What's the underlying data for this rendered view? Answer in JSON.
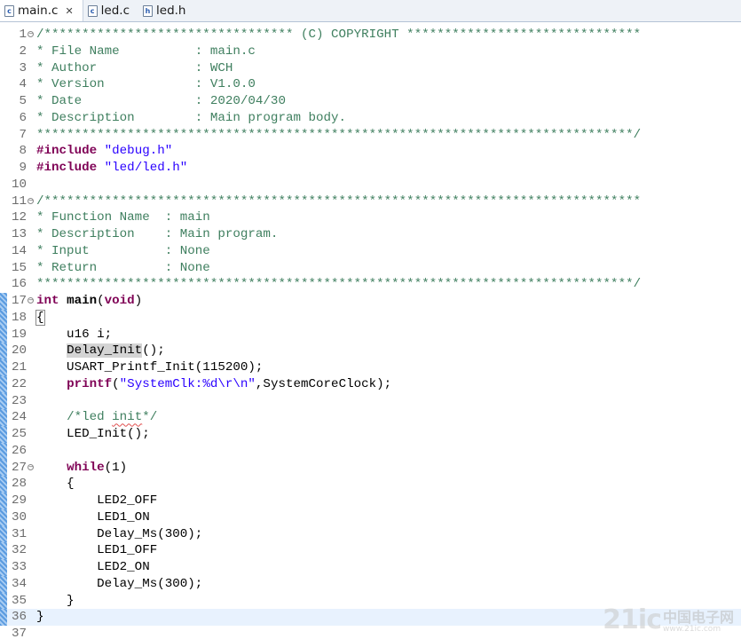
{
  "tabs": [
    {
      "label": "main.c",
      "glyph": "c",
      "active": true,
      "close": "✕"
    },
    {
      "label": "led.c",
      "glyph": "c",
      "active": false
    },
    {
      "label": "led.h",
      "glyph": "h",
      "active": false
    }
  ],
  "watermark": {
    "logo": "21ic",
    "site_cn": "中国电子网",
    "site_url": "www.21ic.com"
  },
  "lines": [
    {
      "n": "1",
      "fold": true,
      "segs": [
        [
          "cm",
          "/********************************* (C) COPYRIGHT *******************************"
        ]
      ]
    },
    {
      "n": "2",
      "segs": [
        [
          "cm",
          "* File Name          : main.c"
        ]
      ]
    },
    {
      "n": "3",
      "segs": [
        [
          "cm",
          "* Author             : WCH"
        ]
      ]
    },
    {
      "n": "4",
      "segs": [
        [
          "cm",
          "* Version            : V1.0.0"
        ]
      ]
    },
    {
      "n": "5",
      "segs": [
        [
          "cm",
          "* Date               : 2020/04/30"
        ]
      ]
    },
    {
      "n": "6",
      "segs": [
        [
          "cm",
          "* Description        : Main program body."
        ]
      ]
    },
    {
      "n": "7",
      "segs": [
        [
          "cm",
          "*******************************************************************************/"
        ]
      ]
    },
    {
      "n": "8",
      "segs": [
        [
          "pp",
          "#include"
        ],
        [
          "",
          " "
        ],
        [
          "str",
          "\"debug.h\""
        ]
      ]
    },
    {
      "n": "9",
      "segs": [
        [
          "pp",
          "#include"
        ],
        [
          "",
          " "
        ],
        [
          "str",
          "\"led/led.h\""
        ]
      ]
    },
    {
      "n": "10",
      "segs": []
    },
    {
      "n": "11",
      "fold": true,
      "segs": [
        [
          "cm",
          "/*******************************************************************************"
        ]
      ]
    },
    {
      "n": "12",
      "segs": [
        [
          "cm",
          "* Function Name  : main"
        ]
      ]
    },
    {
      "n": "13",
      "segs": [
        [
          "cm",
          "* Description    : Main program."
        ]
      ]
    },
    {
      "n": "14",
      "segs": [
        [
          "cm",
          "* Input          : None"
        ]
      ]
    },
    {
      "n": "15",
      "segs": [
        [
          "cm",
          "* Return         : None"
        ]
      ]
    },
    {
      "n": "16",
      "segs": [
        [
          "cm",
          "*******************************************************************************/"
        ]
      ]
    },
    {
      "n": "17",
      "fold": true,
      "mark": true,
      "segs": [
        [
          "kw",
          "int"
        ],
        [
          "",
          " "
        ],
        [
          "fn",
          "main"
        ],
        [
          "",
          "("
        ],
        [
          "kw",
          "void"
        ],
        [
          "",
          ")"
        ]
      ]
    },
    {
      "n": "18",
      "mark": true,
      "segs": [
        [
          "brace",
          "{"
        ]
      ]
    },
    {
      "n": "19",
      "mark": true,
      "segs": [
        [
          "",
          "    u16 i;"
        ]
      ]
    },
    {
      "n": "20",
      "mark": true,
      "segs": [
        [
          "",
          "    "
        ],
        [
          "occ",
          "Delay_Init"
        ],
        [
          "",
          "();"
        ]
      ]
    },
    {
      "n": "21",
      "mark": true,
      "segs": [
        [
          "",
          "    USART_Printf_Init(115200);"
        ]
      ]
    },
    {
      "n": "22",
      "mark": true,
      "segs": [
        [
          "",
          "    "
        ],
        [
          "kw",
          "printf"
        ],
        [
          "",
          "("
        ],
        [
          "str",
          "\"SystemClk:%d\\r\\n\""
        ],
        [
          "",
          ",SystemCoreClock);"
        ]
      ]
    },
    {
      "n": "23",
      "mark": true,
      "segs": []
    },
    {
      "n": "24",
      "mark": true,
      "segs": [
        [
          "",
          "    "
        ],
        [
          "cm",
          "/*led "
        ],
        [
          "cmsq",
          "init"
        ],
        [
          "cm",
          "*/"
        ]
      ]
    },
    {
      "n": "25",
      "mark": true,
      "segs": [
        [
          "",
          "    LED_Init();"
        ]
      ]
    },
    {
      "n": "26",
      "mark": true,
      "segs": []
    },
    {
      "n": "27",
      "fold": true,
      "mark": true,
      "segs": [
        [
          "",
          "    "
        ],
        [
          "kw",
          "while"
        ],
        [
          "",
          "(1)"
        ]
      ]
    },
    {
      "n": "28",
      "mark": true,
      "segs": [
        [
          "",
          "    {"
        ]
      ]
    },
    {
      "n": "29",
      "mark": true,
      "segs": [
        [
          "",
          "        LED2_OFF"
        ]
      ]
    },
    {
      "n": "30",
      "mark": true,
      "segs": [
        [
          "",
          "        LED1_ON"
        ]
      ]
    },
    {
      "n": "31",
      "mark": true,
      "segs": [
        [
          "",
          "        Delay_Ms(300);"
        ]
      ]
    },
    {
      "n": "32",
      "mark": true,
      "segs": [
        [
          "",
          "        LED1_OFF"
        ]
      ]
    },
    {
      "n": "33",
      "mark": true,
      "segs": [
        [
          "",
          "        LED2_ON"
        ]
      ]
    },
    {
      "n": "34",
      "mark": true,
      "segs": [
        [
          "",
          "        Delay_Ms(300);"
        ]
      ]
    },
    {
      "n": "35",
      "mark": true,
      "segs": [
        [
          "",
          "    }"
        ]
      ]
    },
    {
      "n": "36",
      "mark": true,
      "hl": true,
      "segs": [
        [
          "",
          "}"
        ]
      ]
    },
    {
      "n": "37",
      "segs": []
    }
  ]
}
